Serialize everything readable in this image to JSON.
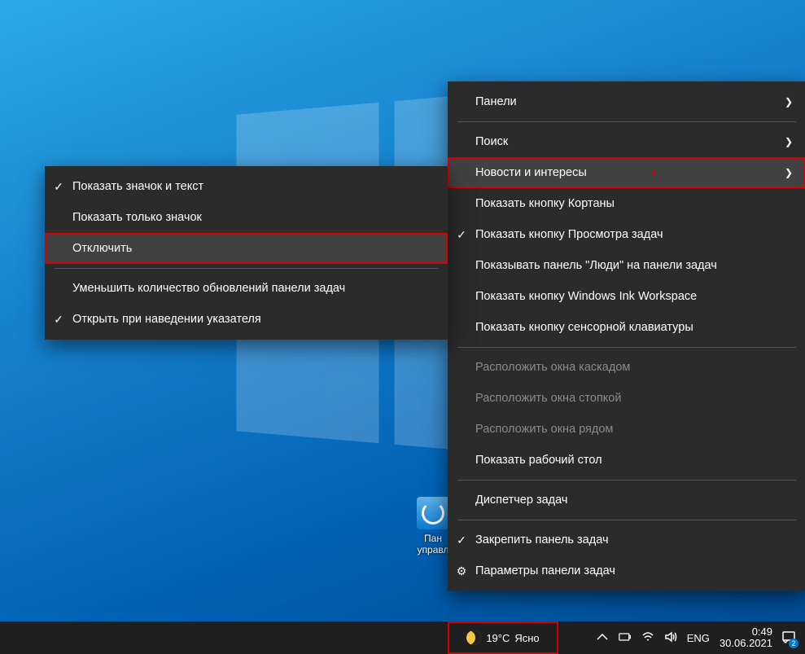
{
  "desktop_icon": {
    "label_line1": "Пан",
    "label_line2": "управл"
  },
  "submenu": {
    "items": [
      {
        "checked": true,
        "label": "Показать значок и текст"
      },
      {
        "checked": false,
        "label": "Показать только значок"
      },
      {
        "checked": false,
        "label": "Отключить",
        "hover": true,
        "highlight": true
      },
      {
        "sep": true
      },
      {
        "checked": false,
        "label": "Уменьшить количество обновлений панели задач"
      },
      {
        "checked": true,
        "label": "Открыть при наведении указателя"
      }
    ]
  },
  "mainmenu": {
    "items": [
      {
        "label": "Панели",
        "arrow": true
      },
      {
        "sep": true
      },
      {
        "label": "Поиск",
        "arrow": true
      },
      {
        "label": "Новости и интересы",
        "arrow": true,
        "hover": true,
        "highlight": true,
        "reddot": true
      },
      {
        "label": "Показать кнопку Кортаны"
      },
      {
        "checked": true,
        "label": "Показать кнопку Просмотра задач"
      },
      {
        "label": "Показывать панель \"Люди\" на панели задач"
      },
      {
        "label": "Показать кнопку Windows Ink Workspace"
      },
      {
        "label": "Показать кнопку сенсорной клавиатуры"
      },
      {
        "sep": true
      },
      {
        "label": "Расположить окна каскадом",
        "disabled": true
      },
      {
        "label": "Расположить окна стопкой",
        "disabled": true
      },
      {
        "label": "Расположить окна рядом",
        "disabled": true
      },
      {
        "label": "Показать рабочий стол"
      },
      {
        "sep": true
      },
      {
        "label": "Диспетчер задач"
      },
      {
        "sep": true
      },
      {
        "checked": true,
        "label": "Закрепить панель задач"
      },
      {
        "gear": true,
        "label": "Параметры панели задач"
      }
    ]
  },
  "taskbar": {
    "weather_temp": "19°C",
    "weather_text": "Ясно",
    "lang": "ENG",
    "time": "0:49",
    "date": "30.06.2021",
    "action_badge": "2"
  }
}
